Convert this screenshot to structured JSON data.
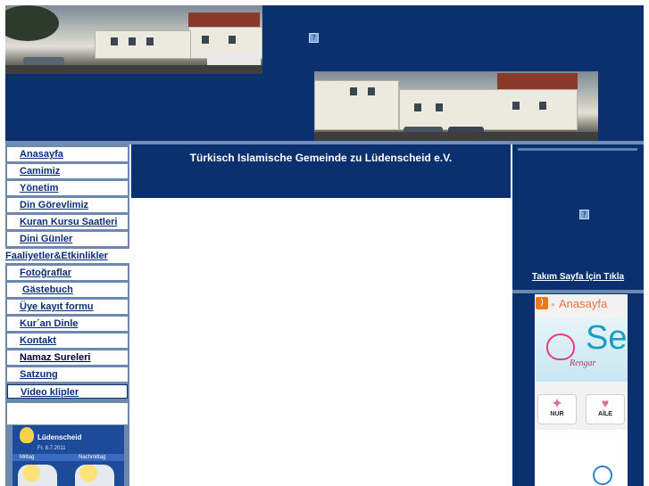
{
  "nav": {
    "items": [
      "Anasayfa",
      "Camimiz",
      "Yönetim",
      "Din Görevlimiz",
      "Kuran Kursu Saatleri",
      "Dini Günler",
      "Faaliyetler&Etkinlikler",
      "Fotoğraflar",
      "Gästebuch",
      "Üye kayıt formu",
      "Kur´an Dinle",
      "Kontakt",
      "Namaz Sureleri",
      "Satzung",
      "Video klipler"
    ]
  },
  "weather": {
    "city": "Lüdenscheid",
    "date": "Fr. 8.7.2011",
    "morning": "Mittag",
    "afternoon": "Nachmittag"
  },
  "main": {
    "title": "Türkisch Islamische Gemeinde zu Lüdenscheid e.V."
  },
  "right": {
    "team_link": "Takım Sayfa İçin Tıkla",
    "broken_image_glyph": "?"
  },
  "widget": {
    "rss_title": "Anasayfa",
    "rss_arrow": "»",
    "banner_text": "Se",
    "banner_script": "Rengar",
    "tile1_label": "NUR",
    "tile2_label": "AİLE"
  },
  "header": {
    "broken_image_glyph": "?"
  },
  "colors": {
    "header_bg": "#0a3070",
    "nav_text": "#0a2f78",
    "rss_orange": "#f07a1a"
  }
}
